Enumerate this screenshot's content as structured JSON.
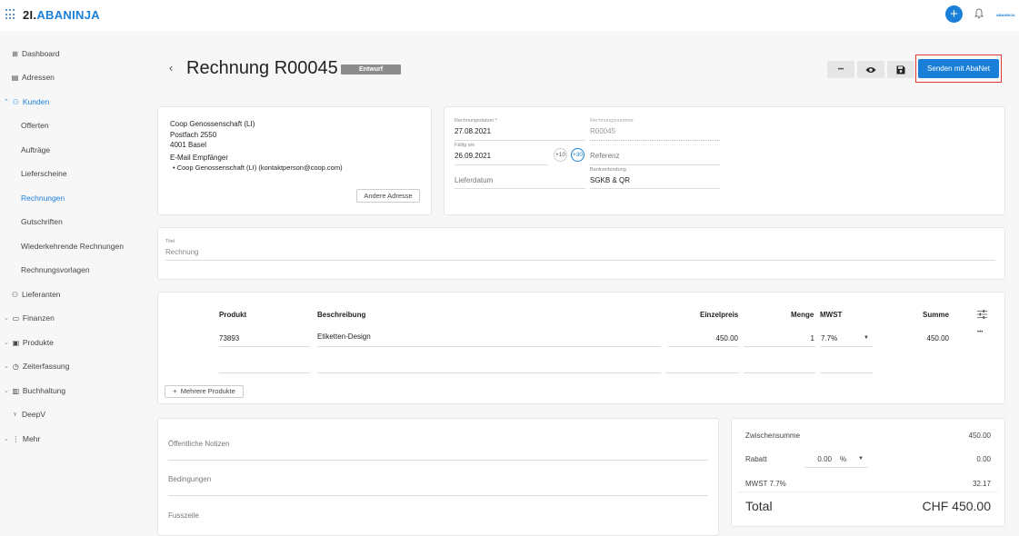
{
  "brand": {
    "part1": "2I.",
    "part2": "ABANINJA",
    "mini": "ABANINJA"
  },
  "sidebar": {
    "dashboard": "Dashboard",
    "adressen": "Adressen",
    "kunden": "Kunden",
    "offerten": "Offerten",
    "auftraege": "Aufträge",
    "lieferscheine": "Lieferscheine",
    "rechnungen": "Rechnungen",
    "gutschriften": "Gutschriften",
    "wiederkehrende": "Wiederkehrende Rechnungen",
    "vorlagen": "Rechnungsvorlagen",
    "lieferanten": "Lieferanten",
    "finanzen": "Finanzen",
    "produkte": "Produkte",
    "zeiterfassung": "Zeiterfassung",
    "buchhaltung": "Buchhaltung",
    "deepv": "DeepV",
    "mehr": "Mehr"
  },
  "header": {
    "back": "‹",
    "title": "Rechnung R00045",
    "status": "Entwurf",
    "more": "•••",
    "send": "Senden mit AbaNet"
  },
  "address": {
    "line1": "Coop Genossenschaft (LI)",
    "line2": "Postfach 2550",
    "line3": "4001 Basel",
    "email_label": "E-Mail Empfänger",
    "email_item": "Coop Genossenschaft (LI) (kontaktperson@coop.com)",
    "other_button": "Andere Adresse"
  },
  "meta": {
    "date_label": "Rechnungsdatum *",
    "date": "27.08.2021",
    "number_label": "Rechnungsnummer",
    "number": "R00045",
    "due_label": "Fällig am",
    "due": "26.09.2021",
    "plus10": "+10",
    "plus30": "+30",
    "reference_placeholder": "Referenz",
    "delivery_placeholder": "Lieferdatum",
    "bank_label": "Bankverbindung",
    "bank": "SGKB & QR"
  },
  "title_field": {
    "label": "Titel",
    "value": "Rechnung"
  },
  "table": {
    "headers": {
      "product": "Produkt",
      "description": "Beschreibung",
      "unit_price": "Einzelpreis",
      "quantity": "Menge",
      "vat": "MWST",
      "sum": "Summe"
    },
    "rows": [
      {
        "product": "73893",
        "description": "Etiketten-Design",
        "unit_price": "450.00",
        "quantity": "1",
        "vat": "7.7%",
        "sum": "450.00",
        "menu": "•••"
      }
    ],
    "add_multiple": "Mehrere Produkte"
  },
  "notes": {
    "public": "Öffentliche Notizen",
    "conditions": "Bedingungen",
    "footer": "Fusszeile"
  },
  "totals": {
    "subtotal_label": "Zwischensumme",
    "subtotal": "450.00",
    "discount_label": "Rabatt",
    "discount_value": "0.00",
    "discount_unit": "%",
    "discount_amount": "0.00",
    "vat_label": "MWST 7.7%",
    "vat": "32.17",
    "total_label": "Total",
    "total": "CHF 450.00"
  },
  "colors": {
    "accent": "#1a7fd8",
    "highlight_border": "#e53935",
    "badge": "#8c8c8c"
  }
}
